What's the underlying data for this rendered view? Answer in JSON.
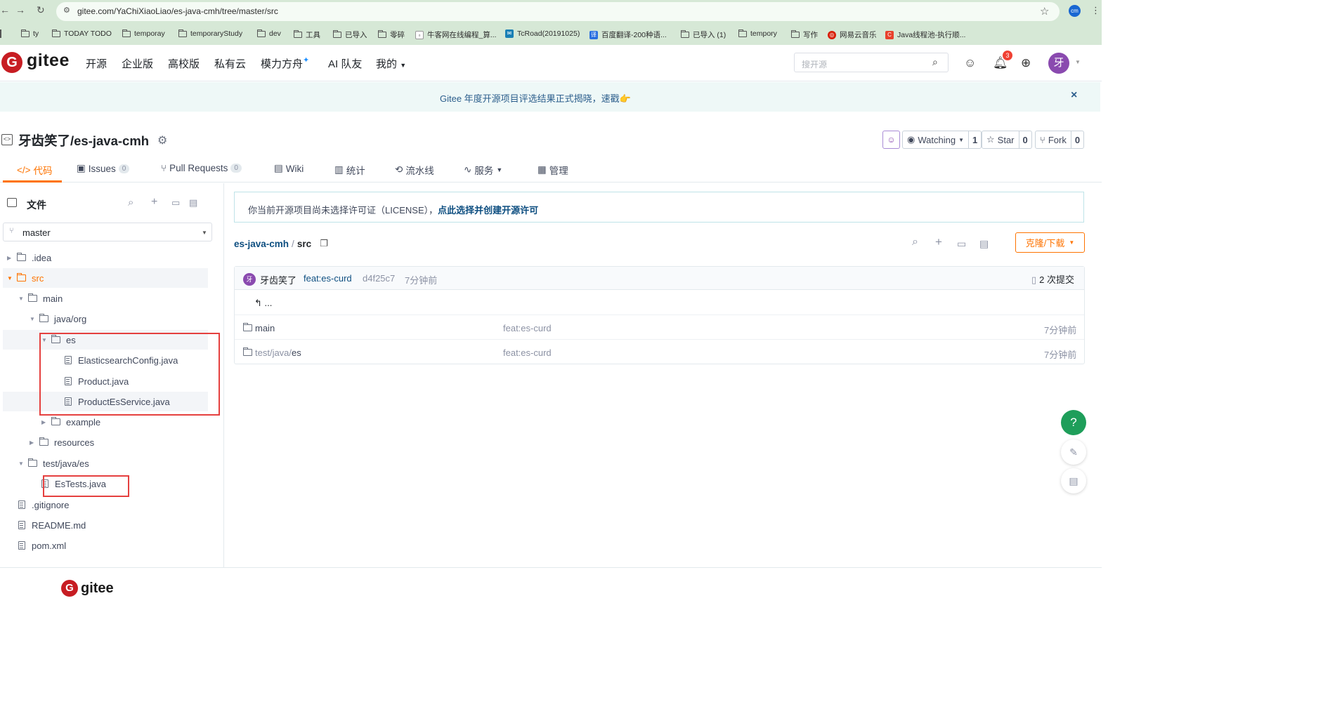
{
  "browser": {
    "url": "gitee.com/YaChiXiaoLiao/es-java-cmh/tree/master/src",
    "profile": "cm",
    "bookmarks": [
      {
        "label": "ty",
        "icon": "folder"
      },
      {
        "label": "TODAY TODO",
        "icon": "folder"
      },
      {
        "label": "temporay",
        "icon": "folder"
      },
      {
        "label": "temporaryStudy",
        "icon": "folder"
      },
      {
        "label": "dev",
        "icon": "folder"
      },
      {
        "label": "工具",
        "icon": "folder"
      },
      {
        "label": "已导入",
        "icon": "folder"
      },
      {
        "label": "零碎",
        "icon": "folder"
      },
      {
        "label": "牛客网在线编程_算...",
        "icon": "nowcoder"
      },
      {
        "label": "TcRoad(20191025)",
        "icon": "site"
      },
      {
        "label": "百度翻译-200种语...",
        "icon": "baidu"
      },
      {
        "label": "已导入 (1)",
        "icon": "folder"
      },
      {
        "label": "tempory",
        "icon": "folder"
      },
      {
        "label": "写作",
        "icon": "folder"
      },
      {
        "label": "网易云音乐",
        "icon": "netease"
      },
      {
        "label": "Java线程池-执行顺...",
        "icon": "csdn"
      }
    ]
  },
  "header": {
    "logo": "gitee",
    "nav": [
      "开源",
      "企业版",
      "高校版",
      "私有云",
      "模力方舟",
      "AI 队友",
      "我的"
    ],
    "search_placeholder": "搜开源",
    "notification_count": "3",
    "avatar": "牙"
  },
  "banner": {
    "text": "Gitee 年度开源项目评选结果正式揭晓，速戳👉",
    "close": "×"
  },
  "repo": {
    "title": "牙齿笑了/es-java-cmh",
    "watching_label": "Watching",
    "watching_count": "1",
    "star_label": "Star",
    "star_count": "0",
    "fork_label": "Fork",
    "fork_count": "0"
  },
  "tabs": [
    {
      "label": "代码",
      "count": ""
    },
    {
      "label": "Issues",
      "count": "0"
    },
    {
      "label": "Pull Requests",
      "count": "0"
    },
    {
      "label": "Wiki",
      "count": ""
    },
    {
      "label": "统计",
      "count": ""
    },
    {
      "label": "流水线",
      "count": ""
    },
    {
      "label": "服务",
      "count": ""
    },
    {
      "label": "管理",
      "count": ""
    }
  ],
  "sidebar": {
    "title": "文件",
    "branch": "master",
    "tree": [
      {
        "label": ".idea",
        "type": "folder"
      },
      {
        "label": "src",
        "type": "folder"
      },
      {
        "label": "main",
        "type": "folder"
      },
      {
        "label": "java/org",
        "type": "folder"
      },
      {
        "label": "es",
        "type": "folder"
      },
      {
        "label": "ElasticsearchConfig.java",
        "type": "file"
      },
      {
        "label": "Product.java",
        "type": "file"
      },
      {
        "label": "ProductEsService.java",
        "type": "file"
      },
      {
        "label": "example",
        "type": "folder"
      },
      {
        "label": "resources",
        "type": "folder"
      },
      {
        "label": "test/java/es",
        "type": "folder"
      },
      {
        "label": "EsTests.java",
        "type": "file"
      },
      {
        "label": ".gitignore",
        "type": "file"
      },
      {
        "label": "README.md",
        "type": "file"
      },
      {
        "label": "pom.xml",
        "type": "file"
      }
    ]
  },
  "main": {
    "license_text": "你当前开源项目尚未选择许可证（LICENSE），",
    "license_link": "点此选择并创建开源许可",
    "breadcrumb_repo": "es-java-cmh",
    "breadcrumb_sep": "/",
    "breadcrumb_dir": "src",
    "clone_label": "克隆/下载",
    "commit": {
      "avatar": "牙",
      "author": "牙齿笑了",
      "message": "feat:es-curd",
      "hash": "d4f25c7",
      "time": "7分钟前",
      "commit_count": "2 次提交"
    },
    "parent_link": "...",
    "files": [
      {
        "name": "main",
        "message": "feat:es-curd",
        "time": "7分钟前"
      },
      {
        "name_prefix": "test/java/",
        "name": "es",
        "message": "feat:es-curd",
        "time": "7分钟前"
      }
    ]
  },
  "floating": {
    "help": "?"
  },
  "footer": {
    "logo": "gitee"
  },
  "colors": {
    "accent": "#fe7300",
    "brand": "#c71d23",
    "link": "#0d4e80",
    "highlight_box": "#e5403f",
    "help_button": "#1e9e5a"
  }
}
